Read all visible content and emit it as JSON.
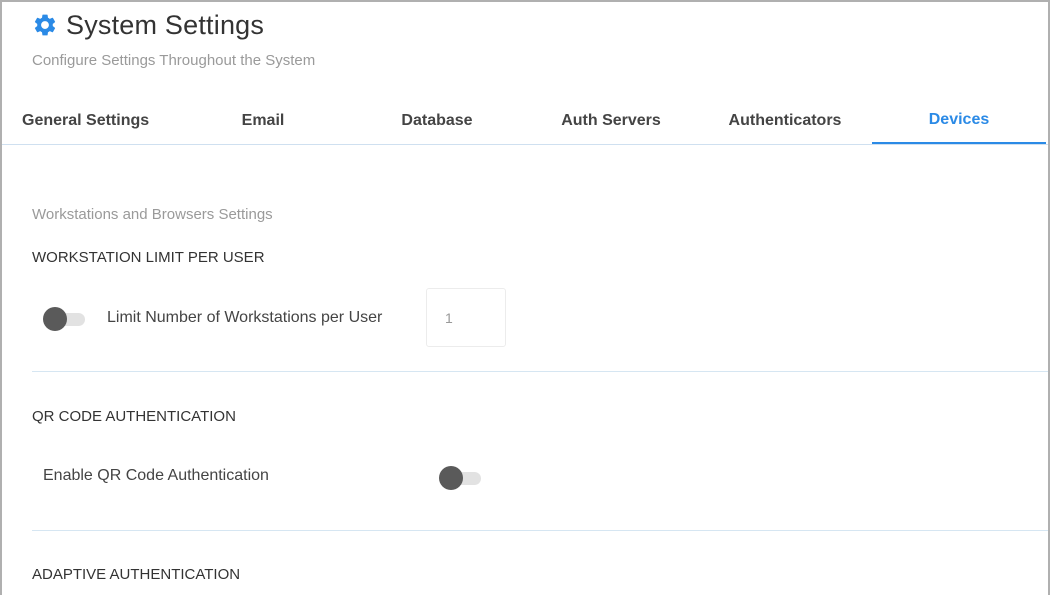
{
  "header": {
    "title": "System Settings",
    "subtitle": "Configure Settings Throughout the System",
    "icon": "gear-icon",
    "icon_color": "#2b8ae6"
  },
  "tabs": [
    {
      "label": "General Settings",
      "active": false
    },
    {
      "label": "Email",
      "active": false
    },
    {
      "label": "Database",
      "active": false
    },
    {
      "label": "Auth Servers",
      "active": false
    },
    {
      "label": "Authenticators",
      "active": false
    },
    {
      "label": "Devices",
      "active": true
    }
  ],
  "accent_color": "#2b8ae6",
  "content": {
    "caption": "Workstations and Browsers Settings",
    "workstation": {
      "heading": "WORKSTATION LIMIT PER USER",
      "toggle_label": "Limit Number of Workstations per User",
      "toggle_on": false,
      "limit_value": "1"
    },
    "qr": {
      "heading": "QR CODE AUTHENTICATION",
      "toggle_label": "Enable QR Code Authentication",
      "toggle_on": false
    },
    "adaptive": {
      "heading": "ADAPTIVE AUTHENTICATION"
    }
  }
}
